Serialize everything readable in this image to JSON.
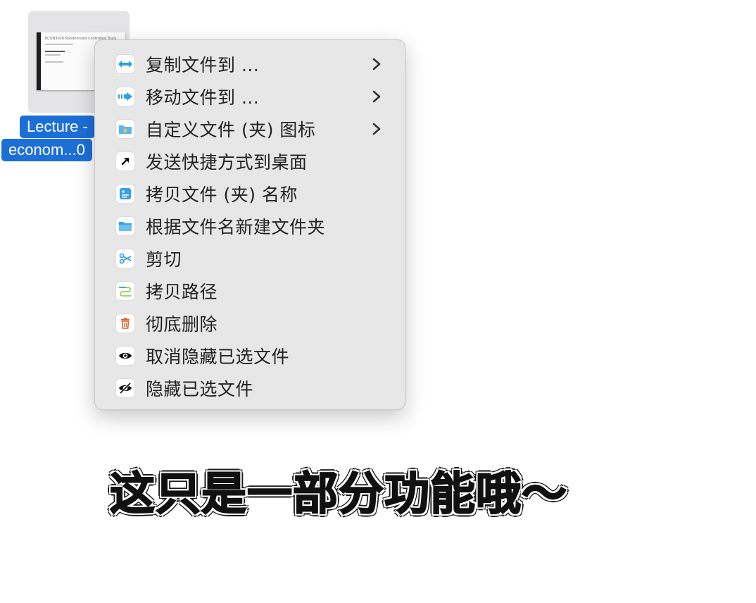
{
  "desktop_file": {
    "label_line1": "Lecture -",
    "label_line2": "econom...0",
    "thumbnail_title": "ECON3026 Randomized Controlled Trials"
  },
  "context_menu": {
    "items": [
      {
        "label": "复制文件到 ...",
        "icon": "copy-to-icon",
        "has_submenu": true
      },
      {
        "label": "移动文件到 ...",
        "icon": "move-to-icon",
        "has_submenu": true
      },
      {
        "label": "自定义文件 (夹) 图标",
        "icon": "custom-folder-icon",
        "has_submenu": true
      },
      {
        "label": "发送快捷方式到桌面",
        "icon": "shortcut-arrow-icon",
        "has_submenu": false
      },
      {
        "label": "拷贝文件 (夹) 名称",
        "icon": "copy-name-icon",
        "has_submenu": false
      },
      {
        "label": "根据文件名新建文件夹",
        "icon": "new-folder-icon",
        "has_submenu": false
      },
      {
        "label": "剪切",
        "icon": "scissors-icon",
        "has_submenu": false
      },
      {
        "label": "拷贝路径",
        "icon": "path-icon",
        "has_submenu": false
      },
      {
        "label": "彻底删除",
        "icon": "trash-icon",
        "has_submenu": false
      },
      {
        "label": "取消隐藏已选文件",
        "icon": "eye-icon",
        "has_submenu": false
      },
      {
        "label": "隐藏已选文件",
        "icon": "eye-slash-icon",
        "has_submenu": false
      }
    ]
  },
  "caption": "这只是一部分功能哦～",
  "colors": {
    "selection_blue": "#1d6fd8",
    "menu_background": "#e7e7e7",
    "icon_blue": "#2a9ee6",
    "trash_orange": "#e0642a"
  }
}
